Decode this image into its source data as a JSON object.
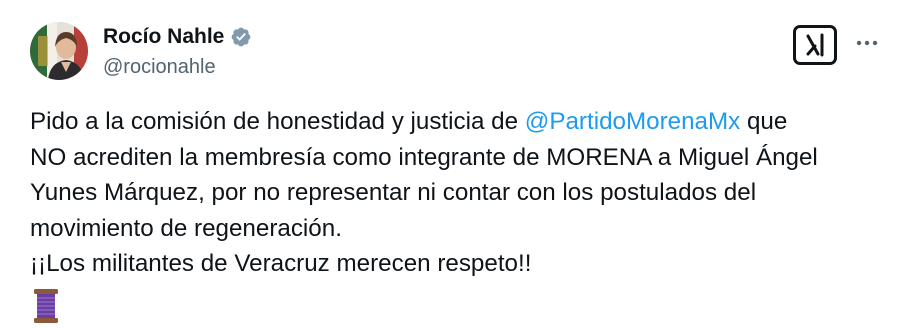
{
  "author": {
    "name": "Rocío Nahle",
    "handle": "@rocionahle"
  },
  "icons": {
    "avatar": "profile-photo",
    "verified": "verified-badge-icon",
    "grok": "grok-icon",
    "more": "more-horizontal-icon",
    "emoji": "spool-of-thread-emoji"
  },
  "colors": {
    "text": "#0f1419",
    "secondary": "#536471",
    "link": "#1d9bf0",
    "verified_badge": "#829aab"
  },
  "tweet": {
    "line1_pre": "Pido a la comisión de honestidad y justicia de ",
    "mention": "@PartidoMorenaMx",
    "line1_post": " que",
    "line2": "NO acrediten la membresía como integrante de MORENA a Miguel Ángel",
    "line3": "Yunes Márquez, por no representar ni contar con los postulados del",
    "line4": "movimiento de regeneración.",
    "line5": "¡¡Los militantes de Veracruz merecen respeto!!"
  }
}
